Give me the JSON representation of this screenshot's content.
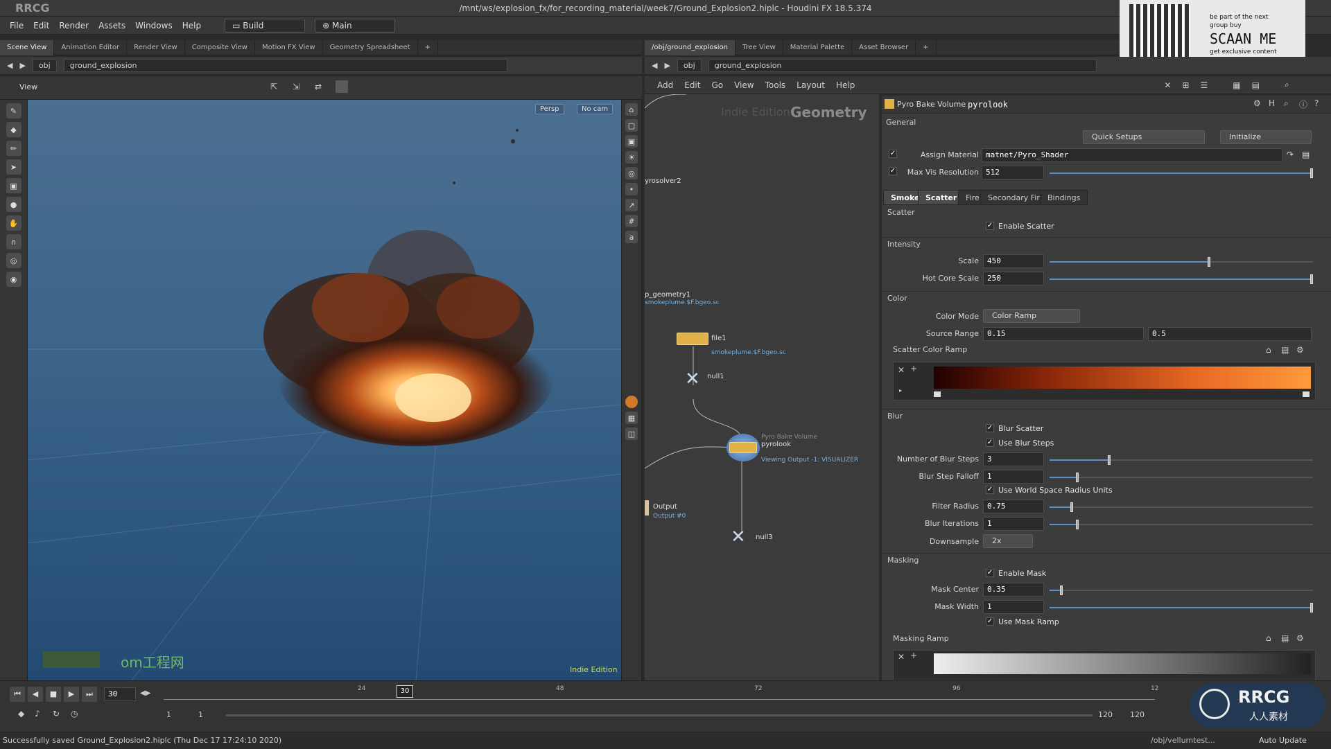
{
  "window": {
    "title": "/mnt/ws/explosion_fx/for_recording_material/week7/Ground_Explosion2.hiplc - Houdini FX 18.5.374",
    "watermark": "RRCG"
  },
  "menu": {
    "items": [
      "File",
      "Edit",
      "Render",
      "Assets",
      "Windows",
      "Help"
    ],
    "desktop": "Build",
    "shelf": "Main"
  },
  "left_tabs": [
    "Scene View",
    "Animation Editor",
    "Render View",
    "Composite View",
    "Motion FX View",
    "Geometry Spreadsheet"
  ],
  "left_path": {
    "root": "obj",
    "node": "ground_explosion"
  },
  "viewport": {
    "label": "View",
    "persp": "Persp",
    "cam": "No cam",
    "edition": "Indie Edition",
    "overlay_text": "om工程网"
  },
  "right_tabs": [
    "/obj/ground_explosion",
    "Tree View",
    "Material Palette",
    "Asset Browser"
  ],
  "right_path": {
    "root": "obj",
    "node": "ground_explosion"
  },
  "network_menu": [
    "Add",
    "Edit",
    "Go",
    "View",
    "Tools",
    "Layout",
    "Help"
  ],
  "network": {
    "watermark": "Indie Edition",
    "context": "Geometry",
    "labels": {
      "pyrosolver": "yrosolver2",
      "import_geo": "p_geometry1",
      "import_file": "smokeplume.$F.bgeo.sc",
      "file1": "file1",
      "file1_sub": "smokeplume.$F.bgeo.sc",
      "null1": "null1",
      "pyrolook_type": "Pyro Bake Volume",
      "pyrolook": "pyrolook",
      "pyrolook_sub": "Viewing Output -1: VISUALIZER",
      "output": "Output",
      "output_sub": "Output #0",
      "null3": "null3"
    }
  },
  "params": {
    "node_type": "Pyro Bake Volume",
    "node_name": "pyrolook",
    "general_label": "General",
    "quick_setups": "Quick Setups",
    "initialize": "Initialize",
    "assign_material_label": "Assign Material",
    "assign_material_value": "matnet/Pyro_Shader",
    "max_vis_label": "Max Vis Resolution",
    "max_vis_value": "512",
    "tabs": [
      "Smoke",
      "Scatter",
      "Fire",
      "Secondary Fire",
      "Bindings"
    ],
    "scatter_section": "Scatter",
    "enable_scatter": "Enable Scatter",
    "intensity_section": "Intensity",
    "scale_label": "Scale",
    "scale_value": "450",
    "hot_core_label": "Hot Core Scale",
    "hot_core_value": "250",
    "color_section": "Color",
    "color_mode_label": "Color Mode",
    "color_mode_value": "Color Ramp",
    "source_range_label": "Source Range",
    "source_range_min": "0.15",
    "source_range_max": "0.5",
    "scatter_ramp_label": "Scatter Color Ramp",
    "blur_section": "Blur",
    "blur_scatter": "Blur Scatter",
    "use_blur_steps": "Use Blur Steps",
    "blur_steps_label": "Number of Blur Steps",
    "blur_steps_value": "3",
    "blur_falloff_label": "Blur Step Falloff",
    "blur_falloff_value": "1",
    "use_world_space": "Use World Space Radius Units",
    "filter_radius_label": "Filter Radius",
    "filter_radius_value": "0.75",
    "blur_iter_label": "Blur Iterations",
    "blur_iter_value": "1",
    "downsample_label": "Downsample",
    "downsample_value": "2x",
    "masking_section": "Masking",
    "enable_mask": "Enable Mask",
    "mask_center_label": "Mask Center",
    "mask_center_value": "0.35",
    "mask_width_label": "Mask Width",
    "mask_width_value": "1",
    "use_mask_ramp": "Use Mask Ramp",
    "masking_ramp_label": "Masking Ramp",
    "slider_levels": {
      "max_vis": 1.0,
      "scale": 0.6,
      "hot_core": 1.0,
      "blur_steps": 0.22,
      "blur_falloff": 0.1,
      "filter_radius": 0.08,
      "blur_iter": 0.1,
      "mask_center": 0.04,
      "mask_width": 1.0
    }
  },
  "timeline": {
    "current_frame": "30",
    "frame_box": "30",
    "ticks": [
      "24",
      "48",
      "72",
      "96",
      "12"
    ],
    "range_start": "1",
    "range_start2": "1",
    "range_end": "120",
    "range_end2": "120"
  },
  "status": {
    "message": "Successfully saved Ground_Explosion2.hiplc (Thu Dec 17 17:24:10 2020)",
    "path": "/obj/vellumtest...",
    "update_mode": "Auto Update"
  },
  "qr_ad": {
    "line1": "be part of the next",
    "line2": "group buy",
    "cta": "SCAAN ME",
    "line3": "get exclusive content"
  },
  "brand": {
    "logo_text": "RRCG",
    "sub_text": "人人素材"
  },
  "colors": {
    "accent": "#5d8fc9",
    "ramp_start": "#200000",
    "ramp_end": "#ff9a3c"
  }
}
